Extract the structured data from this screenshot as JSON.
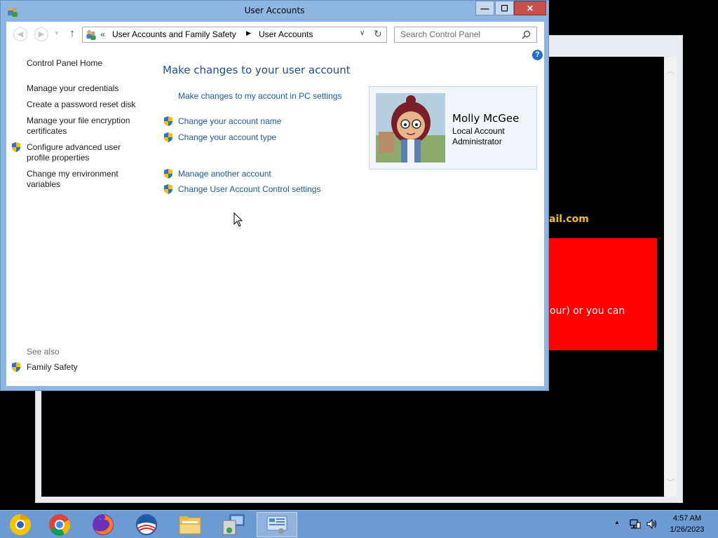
{
  "background_window": {
    "email_fragment": "ail.com",
    "red_box_text": "our) or you can"
  },
  "window": {
    "title": "User Accounts",
    "minimize_label": "—",
    "maximize_label": "☐",
    "close_label": "✕"
  },
  "navbar": {
    "breadcrumbs": [
      "User Accounts and Family Safety",
      "User Accounts"
    ],
    "separator": "▶",
    "overflow_chevron": "«",
    "search_placeholder": "Search Control Panel"
  },
  "left_pane": {
    "home": "Control Panel Home",
    "links": [
      "Manage your credentials",
      "Create a password reset disk",
      "Manage your file encryption certificates",
      "Configure advanced user profile properties",
      "Change my environment variables"
    ],
    "see_also_label": "See also",
    "see_also_links": [
      "Family Safety"
    ]
  },
  "main_pane": {
    "heading": "Make changes to your user account",
    "pc_settings_link": "Make changes to my account in PC settings",
    "tasks": [
      "Change your account name",
      "Change your account type",
      "Manage another account",
      "Change User Account Control settings"
    ]
  },
  "account": {
    "name": "Molly McGee",
    "type": "Local Account",
    "role": "Administrator"
  },
  "taskbar": {
    "apps": [
      {
        "name": "chrome-canary-icon"
      },
      {
        "name": "chrome-icon"
      },
      {
        "name": "firefox-icon"
      },
      {
        "name": "obama-logo-icon"
      },
      {
        "name": "file-explorer-icon"
      },
      {
        "name": "remote-desktop-icon"
      },
      {
        "name": "control-panel-icon",
        "active": true
      }
    ],
    "time": "4:57 AM",
    "date": "1/26/2023"
  },
  "colors": {
    "link": "#1e5aa8",
    "heading": "#1e4e8c",
    "taskbar": "#6c9ad2",
    "window_frame": "#8fb6e3",
    "close_button": "#c7504d"
  }
}
